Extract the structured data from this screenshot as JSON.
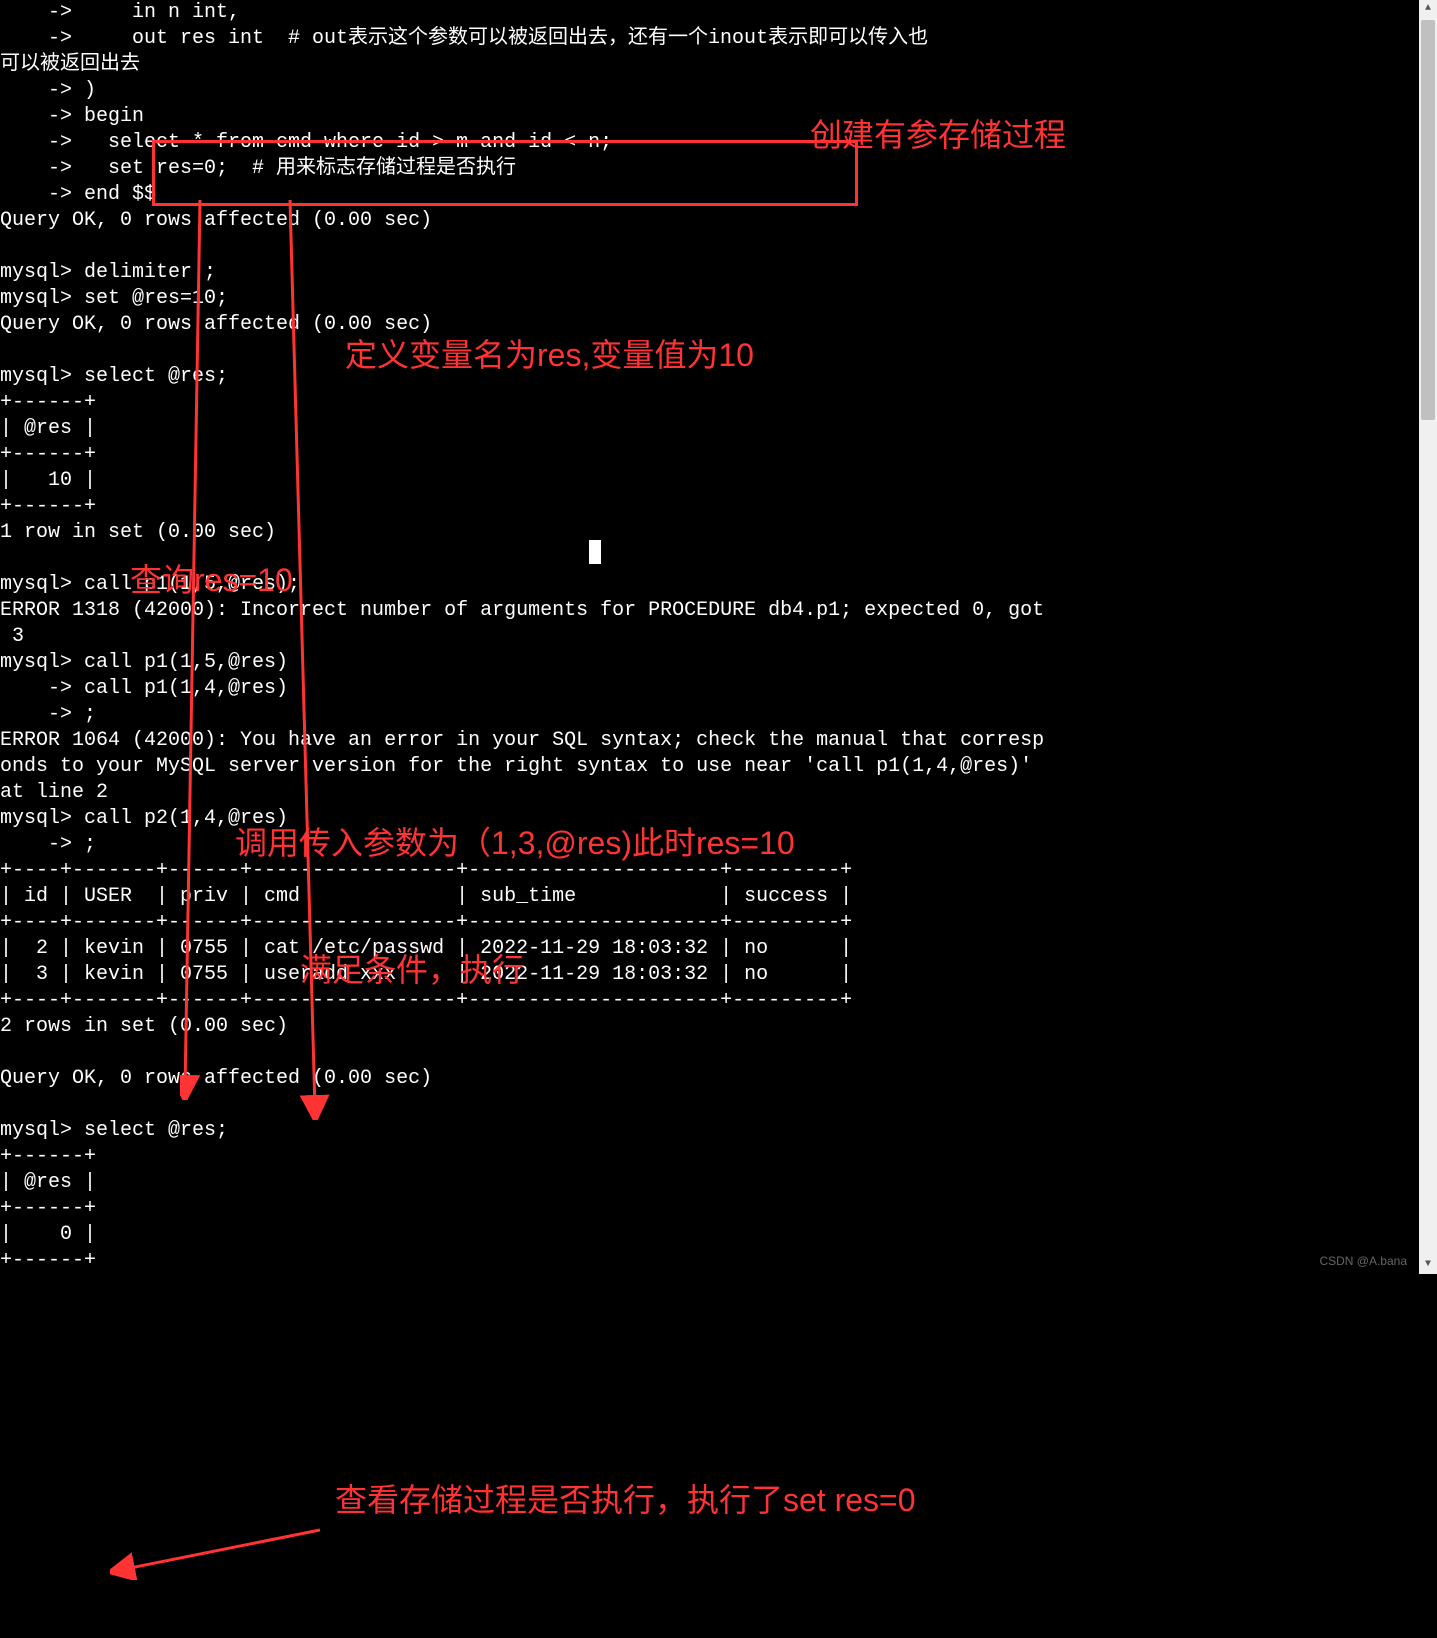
{
  "terminal_lines": [
    "    ->     in n int,",
    "    ->     out res int  # out表示这个参数可以被返回出去，还有一个inout表示即可以传入也",
    "可以被返回出去",
    "    -> )",
    "    -> begin",
    "    ->   select * from cmd where id > m and id < n;",
    "    ->   set res=0;  # 用来标志存储过程是否执行",
    "    -> end $$",
    "Query OK, 0 rows affected (0.00 sec)",
    "",
    "mysql> delimiter ;",
    "mysql> set @res=10;",
    "Query OK, 0 rows affected (0.00 sec)",
    "",
    "mysql> select @res;",
    "+------+",
    "| @res |",
    "+------+",
    "|   10 |",
    "+------+",
    "1 row in set (0.00 sec)",
    "",
    "mysql> call p1(1,5,@res);",
    "ERROR 1318 (42000): Incorrect number of arguments for PROCEDURE db4.p1; expected 0, got",
    " 3",
    "mysql> call p1(1,5,@res)",
    "    -> call p1(1,4,@res)",
    "    -> ;",
    "ERROR 1064 (42000): You have an error in your SQL syntax; check the manual that corresp",
    "onds to your MySQL server version for the right syntax to use near 'call p1(1,4,@res)'",
    "at line 2",
    "mysql> call p2(1,4,@res)",
    "    -> ;",
    "+----+-------+------+-----------------+---------------------+---------+",
    "| id | USER  | priv | cmd             | sub_time            | success |",
    "+----+-------+------+-----------------+---------------------+---------+",
    "|  2 | kevin | 0755 | cat /etc/passwd | 2022-11-29 18:03:32 | no      |",
    "|  3 | kevin | 0755 | useradd xxx     | 2022-11-29 18:03:32 | no      |",
    "+----+-------+------+-----------------+---------------------+---------+",
    "2 rows in set (0.00 sec)",
    "",
    "Query OK, 0 rows affected (0.00 sec)",
    "",
    "mysql> select @res;",
    "+------+",
    "| @res |",
    "+------+",
    "|    0 |",
    "+------+"
  ],
  "annotations": {
    "a1": "创建有参存储过程",
    "a2": "定义变量名为res,变量值为10",
    "a3": "查询res=10",
    "a4": "调用传入参数为（1,3,@res)此时res=10",
    "a5": "满足条件，执行",
    "a6": "查看存储过程是否执行，执行了set res=0"
  },
  "table": {
    "headers": [
      "id",
      "USER",
      "priv",
      "cmd",
      "sub_time",
      "success"
    ],
    "rows": [
      {
        "id": "2",
        "USER": "kevin",
        "priv": "0755",
        "cmd": "cat /etc/passwd",
        "sub_time": "2022-11-29 18:03:32",
        "success": "no"
      },
      {
        "id": "3",
        "USER": "kevin",
        "priv": "0755",
        "cmd": "useradd xxx",
        "sub_time": "2022-11-29 18:03:32",
        "success": "no"
      }
    ]
  },
  "watermark": "CSDN @A.bana"
}
